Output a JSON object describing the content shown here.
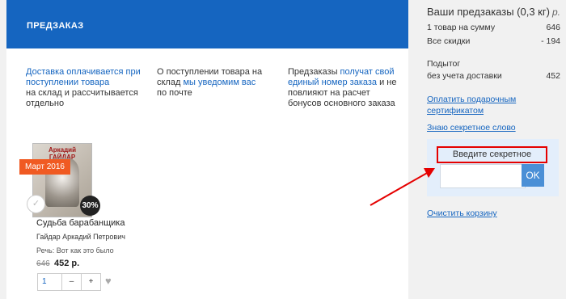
{
  "tab": {
    "label": "ПРЕДЗАКАЗ"
  },
  "info": [
    {
      "link": "Доставка оплачивается при поступлении товара",
      "text": "на склад и рассчитывается отдельно"
    },
    {
      "text_before": "О поступлении товара на склад ",
      "link": "мы уведомим вас",
      "text_after": "по почте"
    },
    {
      "text_before": "Предзаказы ",
      "link": "получат свой единый номер заказа",
      "text_after": " и не повлияют на расчет бонусов основного заказа"
    }
  ],
  "product": {
    "cover_title": "Аркадий ГАЙДАР",
    "date_badge": "Март 2016",
    "check_icon": "✓",
    "discount": "30%",
    "name": "Судьба барабанщика",
    "author": "Гайдар Аркадий Петрович",
    "note": "Речь: Вот как это было",
    "old_price": "646",
    "price": "452 р.",
    "quantity": "1",
    "minus": "–",
    "plus": "+",
    "heart_icon": "♥"
  },
  "sidebar": {
    "title": "Ваши предзаказы (0,3 кг)",
    "currency": "р.",
    "rows": [
      {
        "label": "1 товар на сумму",
        "value": "646"
      },
      {
        "label": "Все скидки",
        "value": "- 194"
      }
    ],
    "subtotal_label": "Подытог",
    "subtotal_sub": "без учета доставки",
    "subtotal_value": "452",
    "pay_cert_link": "Оплатить подарочным сертификатом",
    "secret_link": "Знаю секретное слово",
    "secret_label": "Введите секретное слово:",
    "secret_value": "",
    "ok_label": "OK",
    "clear_link": "Очистить корзину"
  },
  "colors": {
    "brand": "#1565c0",
    "badge": "#f05a22",
    "highlight": "#e50000"
  }
}
